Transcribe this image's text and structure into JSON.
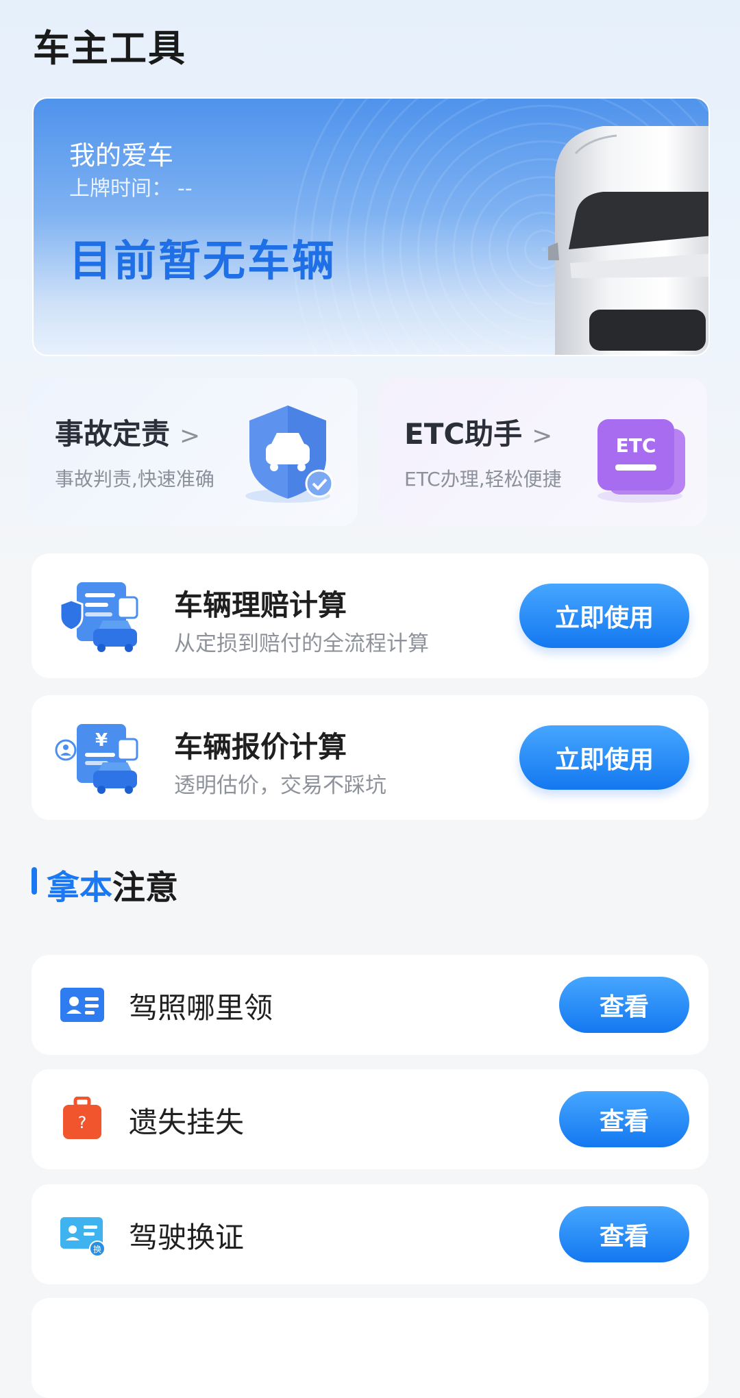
{
  "page": {
    "title": "车主工具"
  },
  "my_car": {
    "label": "我的爱车",
    "plate_time_label": "上牌时间：",
    "plate_time_value": "--",
    "empty_message": "目前暂无车辆"
  },
  "quick_tiles": [
    {
      "title": "事故定责",
      "desc": "事故判责,快速准确",
      "icon": "shield-car-icon"
    },
    {
      "title": "ETC助手",
      "desc": "ETC办理,轻松便捷",
      "icon": "etc-card-icon",
      "icon_text": "ETC"
    }
  ],
  "calc_cards": [
    {
      "title": "车辆理赔计算",
      "desc": "从定损到赔付的全流程计算",
      "button": "立即使用",
      "icon": "claim-calculator-icon"
    },
    {
      "title": "车辆报价计算",
      "desc": "透明估价，交易不踩坑",
      "button": "立即使用",
      "icon": "price-calculator-icon",
      "icon_text": "¥"
    }
  ],
  "section": {
    "title_highlight": "拿本",
    "title_rest": "注意"
  },
  "list": [
    {
      "label": "驾照哪里领",
      "button": "查看",
      "icon": "id-card-icon"
    },
    {
      "label": "遗失挂失",
      "button": "查看",
      "icon": "lost-luggage-icon",
      "icon_text": "?"
    },
    {
      "label": "驾驶换证",
      "button": "查看",
      "icon": "license-renew-icon",
      "icon_text": "换"
    }
  ],
  "colors": {
    "accent": "#1a78f2",
    "button_gradient_top": "#46a6ff",
    "button_gradient_bottom": "#1378f0"
  }
}
